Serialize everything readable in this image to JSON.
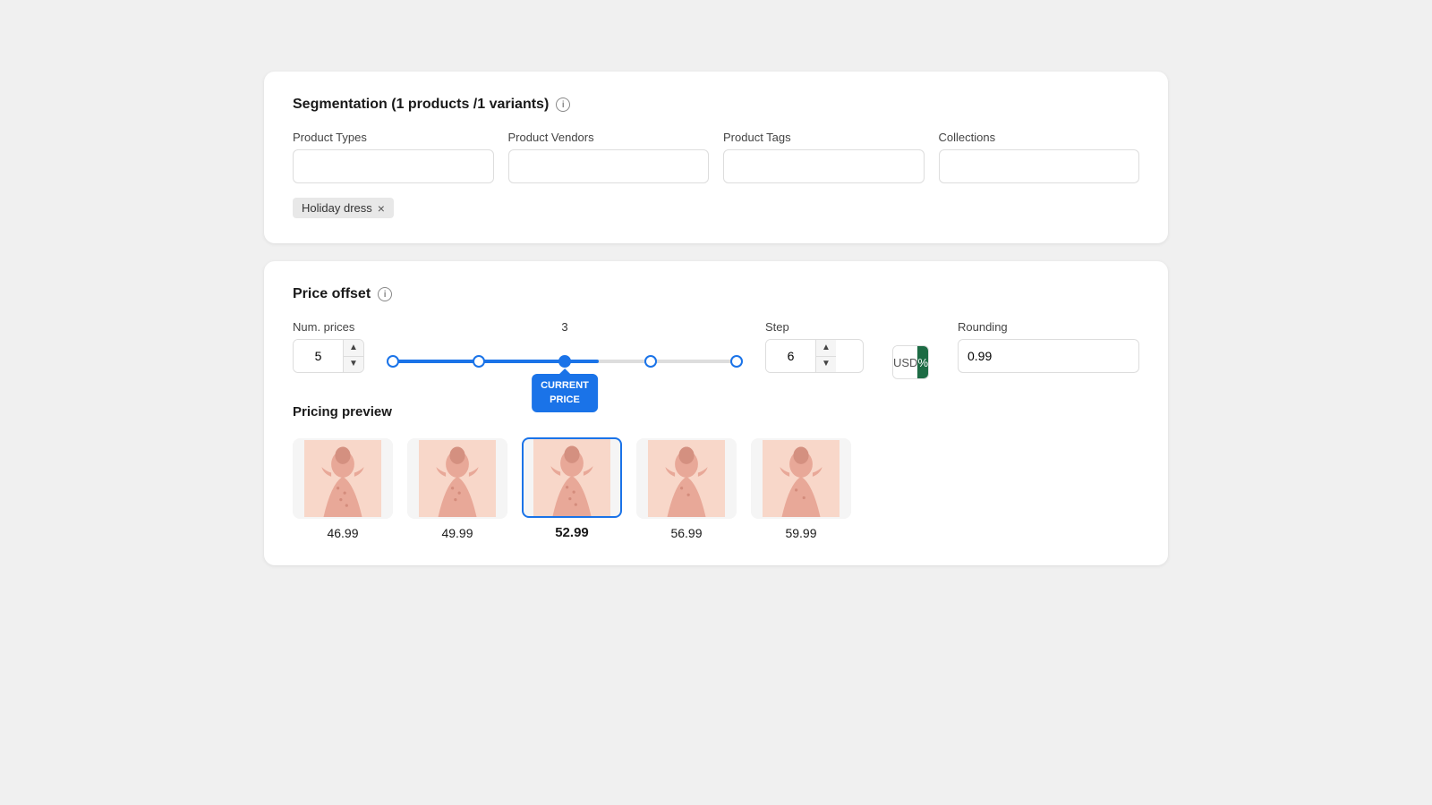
{
  "segmentation": {
    "title": "Segmentation (1 products /1 variants)",
    "info_icon": "i",
    "fields": {
      "product_types": {
        "label": "Product Types",
        "value": ""
      },
      "product_vendors": {
        "label": "Product Vendors",
        "value": ""
      },
      "product_tags": {
        "label": "Product Tags",
        "value": ""
      },
      "collections": {
        "label": "Collections",
        "value": ""
      }
    },
    "tags": [
      {
        "label": "Holiday dress",
        "removable": true
      }
    ]
  },
  "price_offset": {
    "title": "Price offset",
    "num_prices": {
      "label": "Num. prices",
      "value": "5"
    },
    "slider": {
      "value_label": "3",
      "dots": [
        0,
        25,
        50,
        75,
        100
      ],
      "active_index": 2,
      "fill_percent": 50
    },
    "tooltip": {
      "line1": "CURRENT",
      "line2": "PRICE"
    },
    "step": {
      "label": "Step",
      "value": "6"
    },
    "currency": {
      "options": [
        "USD",
        "%"
      ],
      "active": "%"
    },
    "rounding": {
      "label": "Rounding",
      "value": "0.99"
    }
  },
  "pricing_preview": {
    "title": "Pricing preview",
    "items": [
      {
        "price": "46.99",
        "selected": false
      },
      {
        "price": "49.99",
        "selected": false
      },
      {
        "price": "52.99",
        "selected": true
      },
      {
        "price": "56.99",
        "selected": false
      },
      {
        "price": "59.99",
        "selected": false
      }
    ]
  }
}
